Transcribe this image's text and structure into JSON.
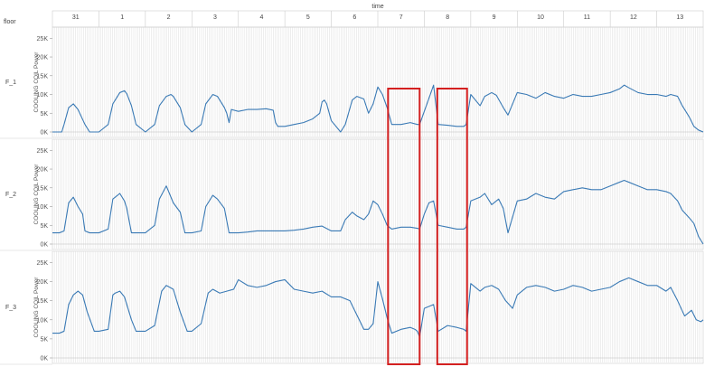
{
  "chart_data": {
    "type": "line",
    "x_field_label": "time",
    "row_field_label": "floor",
    "ylabel": "COOLING COIL Power",
    "x_day_labels": [
      "31",
      "1",
      "2",
      "3",
      "4",
      "5",
      "6",
      "7",
      "8",
      "9",
      "10",
      "11",
      "12",
      "13"
    ],
    "ylim": [
      0,
      27000
    ],
    "y_ticks": [
      0,
      5000,
      10000,
      15000,
      20000,
      25000
    ],
    "y_tick_labels": [
      "0K",
      "5K",
      "10K",
      "15K",
      "20K",
      "25K"
    ],
    "x_range_days": [
      0,
      14
    ],
    "colors": {
      "series": "#3a7ab5",
      "highlight": "#d42020",
      "grid": "#dedede"
    },
    "highlight_ranges_days": [
      [
        7.22,
        7.9
      ],
      [
        8.28,
        8.92
      ]
    ],
    "series": [
      {
        "name": "F_1",
        "x": [
          0,
          0.2,
          0.25,
          0.35,
          0.45,
          0.55,
          0.7,
          0.8,
          1.0,
          1.2,
          1.3,
          1.45,
          1.55,
          1.6,
          1.7,
          1.8,
          2.0,
          2.2,
          2.3,
          2.45,
          2.55,
          2.6,
          2.75,
          2.85,
          3.0,
          3.2,
          3.3,
          3.45,
          3.55,
          3.7,
          3.75,
          3.8,
          3.85,
          4.0,
          4.2,
          4.4,
          4.6,
          4.75,
          4.8,
          4.85,
          5.0,
          5.2,
          5.4,
          5.6,
          5.75,
          5.8,
          5.85,
          5.9,
          6.0,
          6.2,
          6.3,
          6.45,
          6.55,
          6.7,
          6.8,
          6.9,
          7.0,
          7.1,
          7.2,
          7.3,
          7.5,
          7.7,
          7.85,
          7.9,
          8.0,
          8.1,
          8.2,
          8.3,
          8.5,
          8.7,
          8.85,
          8.9,
          9.0,
          9.2,
          9.3,
          9.45,
          9.55,
          9.7,
          9.8,
          10.0,
          10.2,
          10.4,
          10.6,
          10.8,
          11.0,
          11.2,
          11.4,
          11.6,
          11.8,
          12.0,
          12.2,
          12.3,
          12.4,
          12.6,
          12.8,
          13.0,
          13.2,
          13.3,
          13.45,
          13.55,
          13.7,
          13.8,
          13.9,
          14.0
        ],
        "y": [
          0,
          0,
          2000,
          6500,
          7500,
          6000,
          2000,
          0,
          0,
          2000,
          7500,
          10500,
          11000,
          10200,
          7000,
          2000,
          0,
          2000,
          7000,
          9500,
          10000,
          9500,
          6500,
          2000,
          0,
          2000,
          7500,
          10000,
          9500,
          6500,
          5000,
          2500,
          6000,
          5500,
          6000,
          6000,
          6200,
          5800,
          2500,
          1500,
          1500,
          2000,
          2500,
          3500,
          5000,
          8000,
          8500,
          7500,
          3000,
          0,
          2000,
          8500,
          9500,
          8800,
          5000,
          7500,
          12000,
          10000,
          6500,
          2000,
          2000,
          2500,
          2000,
          2000,
          5500,
          9000,
          12500,
          2000,
          1800,
          1500,
          1500,
          2000,
          10000,
          7000,
          9500,
          10500,
          9800,
          6500,
          4500,
          10500,
          10000,
          9000,
          10500,
          9500,
          9000,
          10000,
          9500,
          9500,
          10000,
          10500,
          11500,
          12500,
          11800,
          10500,
          10000,
          10000,
          9500,
          10000,
          9500,
          7000,
          4000,
          1500,
          500,
          0
        ]
      },
      {
        "name": "F_2",
        "x": [
          0,
          0.15,
          0.25,
          0.35,
          0.45,
          0.55,
          0.65,
          0.7,
          0.8,
          1.0,
          1.2,
          1.3,
          1.45,
          1.55,
          1.6,
          1.7,
          1.8,
          2.0,
          2.2,
          2.3,
          2.45,
          2.6,
          2.75,
          2.85,
          3.0,
          3.2,
          3.3,
          3.45,
          3.55,
          3.7,
          3.8,
          4.0,
          4.2,
          4.4,
          4.6,
          4.8,
          5.0,
          5.2,
          5.4,
          5.6,
          5.8,
          6.0,
          6.2,
          6.3,
          6.45,
          6.55,
          6.7,
          6.8,
          6.9,
          7.0,
          7.1,
          7.2,
          7.3,
          7.5,
          7.7,
          7.85,
          7.9,
          8.0,
          8.1,
          8.2,
          8.3,
          8.5,
          8.7,
          8.85,
          8.9,
          9.0,
          9.2,
          9.3,
          9.45,
          9.6,
          9.7,
          9.8,
          10.0,
          10.2,
          10.4,
          10.6,
          10.8,
          11.0,
          11.2,
          11.4,
          11.6,
          11.8,
          12.0,
          12.2,
          12.3,
          12.4,
          12.6,
          12.8,
          13.0,
          13.2,
          13.3,
          13.45,
          13.55,
          13.7,
          13.8,
          13.9,
          14.0
        ],
        "y": [
          3000,
          3000,
          3500,
          11000,
          12500,
          10000,
          8000,
          3500,
          3000,
          3000,
          4000,
          12000,
          13500,
          11500,
          9500,
          3000,
          3000,
          3000,
          5000,
          12000,
          15500,
          11000,
          8500,
          3000,
          3000,
          3500,
          10000,
          13000,
          12000,
          9500,
          3000,
          3000,
          3200,
          3500,
          3500,
          3500,
          3500,
          3700,
          4000,
          4500,
          4800,
          3500,
          3500,
          6500,
          8500,
          7500,
          6500,
          8000,
          11500,
          10500,
          8000,
          5000,
          4000,
          4500,
          4500,
          4200,
          4000,
          8000,
          11000,
          11500,
          5000,
          4500,
          4000,
          4000,
          4500,
          11500,
          12500,
          13500,
          10500,
          12000,
          9500,
          3000,
          11500,
          12000,
          13500,
          12500,
          12000,
          14000,
          14500,
          15000,
          14500,
          14500,
          15500,
          16500,
          17000,
          16500,
          15500,
          14500,
          14500,
          14000,
          13500,
          11500,
          9000,
          7000,
          5500,
          2000,
          0
        ]
      },
      {
        "name": "F_3",
        "x": [
          0,
          0.15,
          0.25,
          0.35,
          0.45,
          0.55,
          0.65,
          0.75,
          0.9,
          1.0,
          1.2,
          1.3,
          1.35,
          1.45,
          1.55,
          1.7,
          1.8,
          2.0,
          2.2,
          2.35,
          2.45,
          2.6,
          2.75,
          2.9,
          3.0,
          3.2,
          3.35,
          3.45,
          3.6,
          3.75,
          3.9,
          4.0,
          4.2,
          4.4,
          4.6,
          4.8,
          5.0,
          5.2,
          5.4,
          5.6,
          5.8,
          6.0,
          6.2,
          6.4,
          6.5,
          6.6,
          6.7,
          6.8,
          6.9,
          7.0,
          7.1,
          7.2,
          7.3,
          7.5,
          7.7,
          7.8,
          7.85,
          7.9,
          8.0,
          8.2,
          8.3,
          8.5,
          8.7,
          8.85,
          8.9,
          9.0,
          9.2,
          9.3,
          9.45,
          9.6,
          9.75,
          9.9,
          10.0,
          10.2,
          10.4,
          10.6,
          10.8,
          11.0,
          11.2,
          11.4,
          11.6,
          11.8,
          12.0,
          12.2,
          12.4,
          12.6,
          12.8,
          13.0,
          13.2,
          13.3,
          13.45,
          13.6,
          13.75,
          13.85,
          13.95,
          14.0
        ],
        "y": [
          6500,
          6500,
          7000,
          14000,
          16500,
          17500,
          16500,
          12000,
          7000,
          7000,
          7500,
          16500,
          17000,
          17500,
          16000,
          10000,
          7000,
          7000,
          8500,
          17500,
          19000,
          18000,
          12000,
          7000,
          7000,
          9000,
          17000,
          18000,
          17000,
          17500,
          18000,
          20500,
          19000,
          18500,
          19000,
          20000,
          20500,
          18000,
          17500,
          17000,
          17500,
          16000,
          16000,
          15000,
          12500,
          10000,
          7500,
          7500,
          9000,
          20000,
          15500,
          10500,
          6500,
          7500,
          8000,
          7500,
          7000,
          5500,
          13000,
          14000,
          7000,
          8500,
          8000,
          7500,
          7000,
          19500,
          17500,
          18500,
          19000,
          18000,
          15000,
          13000,
          16500,
          18500,
          19000,
          18500,
          17500,
          18000,
          19000,
          18500,
          17500,
          18000,
          18500,
          20000,
          21000,
          20000,
          19000,
          19000,
          17500,
          18500,
          15000,
          11000,
          12500,
          10000,
          9500,
          10000
        ]
      }
    ]
  }
}
